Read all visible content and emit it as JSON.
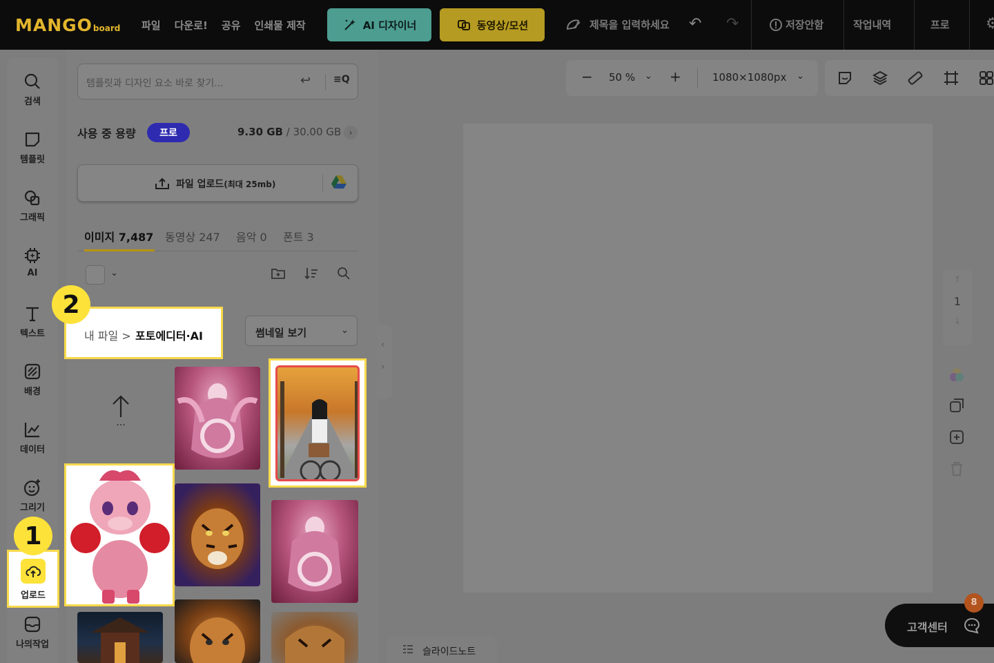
{
  "topbar": {
    "logo_main": "MANGO",
    "logo_sub": "board",
    "nav": [
      "파일",
      "다운로!",
      "공유",
      "인쇄물 제작"
    ],
    "ai_designer": "AI 디자이너",
    "video_motion": "동영상/모션",
    "title_placeholder": "제목을 입력하세요",
    "save_status": "저장안함",
    "history": "작업내역",
    "pro": "프로"
  },
  "rail": {
    "items": [
      "검색",
      "템플릿",
      "그래픽",
      "AI",
      "텍스트",
      "배경",
      "데이터",
      "그리기"
    ],
    "upload": "업로드",
    "my_work": "나의작업"
  },
  "panel": {
    "search_placeholder": "템플릿과 디자인 요소 바로 찾기...",
    "usage_label": "사용 중 용량",
    "pro_badge": "프로",
    "usage_used": "9.30 GB",
    "usage_total": " / 30.00 GB",
    "upload_label": "파일 업로드",
    "upload_limit": "(최대 25mb)",
    "tabs": [
      "이미지 7,487",
      "동영상 247",
      "음악 0",
      "폰트 3"
    ],
    "breadcrumb_root": "내 파일",
    "breadcrumb_sep": ">",
    "breadcrumb_current": "포토에디터·AI",
    "view_mode": "썸네일 보기",
    "up_more": "..."
  },
  "canvas": {
    "zoom": "50 %",
    "size": "1080×1080px",
    "page_number": "1"
  },
  "annotations": {
    "one": "1",
    "two": "2"
  },
  "footer": {
    "slide_note": "슬라이드노트",
    "support": "고객센터",
    "support_count": "8"
  }
}
